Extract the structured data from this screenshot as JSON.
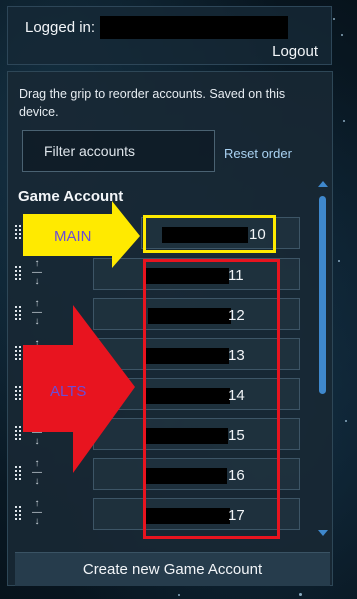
{
  "header": {
    "logged_in_label": "Logged in:",
    "logout_label": "Logout"
  },
  "panel": {
    "hint": "Drag the grip to reorder accounts. Saved on this device.",
    "filter_placeholder": "Filter accounts",
    "reset_label": "Reset order",
    "column_header": "Game Account"
  },
  "accounts": [
    {
      "number": "10"
    },
    {
      "number": "11"
    },
    {
      "number": "12"
    },
    {
      "number": "13"
    },
    {
      "number": "14"
    },
    {
      "number": "15"
    },
    {
      "number": "16"
    },
    {
      "number": "17"
    }
  ],
  "footer": {
    "create_label": "Create new Game Account"
  },
  "annotations": {
    "main_label": "MAIN",
    "alts_label": "ALTS",
    "main_color": "#ffea00",
    "alts_color": "#e8141f"
  },
  "colors": {
    "scrollbar": "#3f88cc",
    "link": "#a9d2f2"
  }
}
